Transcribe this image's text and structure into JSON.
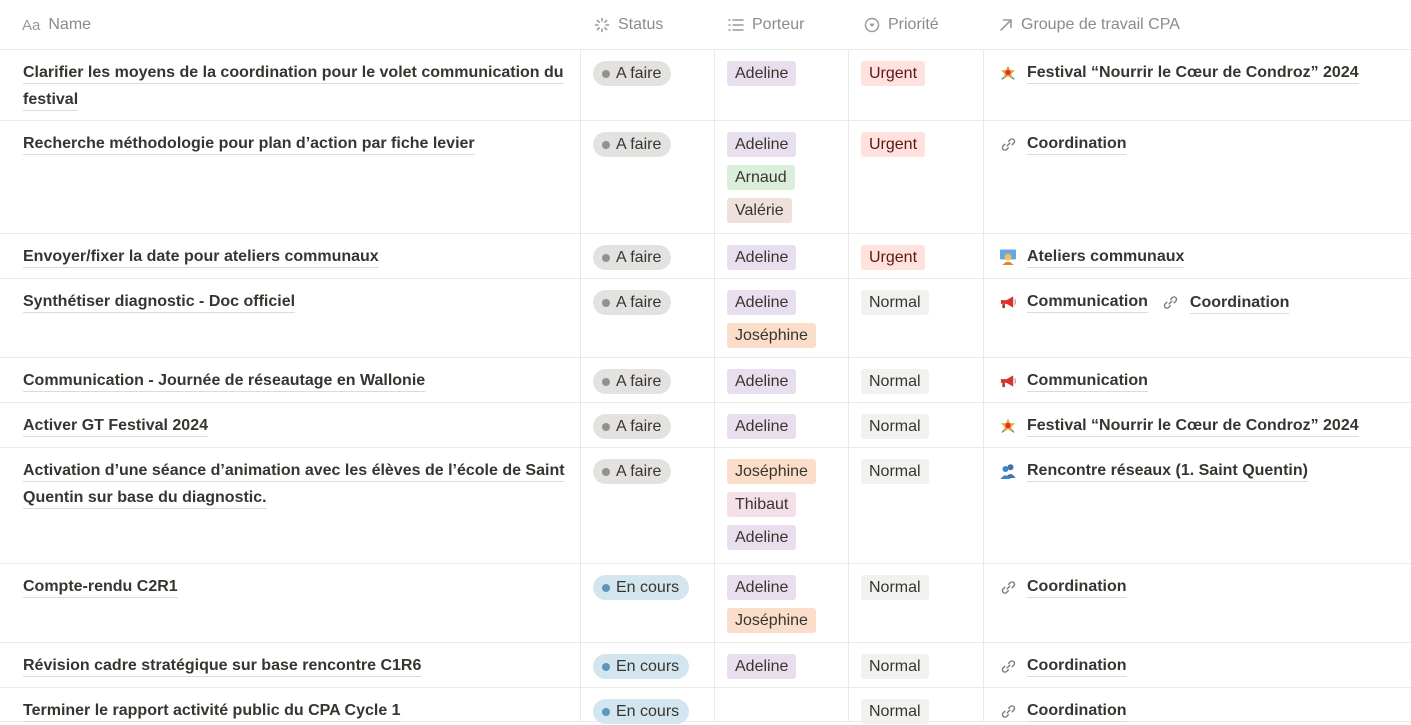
{
  "columns": {
    "name": "Name",
    "name_icon_text": "Aa",
    "status": "Status",
    "porteur": "Porteur",
    "priorite": "Priorité",
    "groupe": "Groupe de travail CPA"
  },
  "colors": {
    "status": {
      "A faire": {
        "bg": "#e3e2e0",
        "dot": "#91918e"
      },
      "En cours": {
        "bg": "#d3e5ef",
        "dot": "#5b97bd"
      }
    },
    "porteur": {
      "Adeline": "#e8deee",
      "Arnaud": "#dbeddb",
      "Valérie": "#eee0da",
      "Joséphine": "#fadec9",
      "Thibaut": "#f5e0e9"
    },
    "priorite": {
      "Urgent": "#ffe2dd",
      "Normal": "#f1f1ef"
    }
  },
  "rows": [
    {
      "name": "Clarifier les moyens de la coordination pour le volet communication du festival",
      "status": "A faire",
      "porteur": [
        "Adeline"
      ],
      "priorite": "Urgent",
      "groupe": [
        {
          "label": "Festival “Nourrir le Cœur de Condroz” 2024",
          "icon": "festival-icon"
        }
      ]
    },
    {
      "name": "Recherche méthodologie pour plan d’action par fiche levier",
      "status": "A faire",
      "porteur": [
        "Adeline",
        "Arnaud",
        "Valérie"
      ],
      "priorite": "Urgent",
      "groupe": [
        {
          "label": "Coordination",
          "icon": "link-icon"
        }
      ]
    },
    {
      "name": "Envoyer/fixer la date pour ateliers communaux",
      "status": "A faire",
      "porteur": [
        "Adeline"
      ],
      "priorite": "Urgent",
      "groupe": [
        {
          "label": "Ateliers communaux",
          "icon": "teacher-icon"
        }
      ]
    },
    {
      "name": "Synthétiser diagnostic - Doc officiel",
      "status": "A faire",
      "porteur": [
        "Adeline",
        "Joséphine"
      ],
      "priorite": "Normal",
      "groupe": [
        {
          "label": "Communication",
          "icon": "megaphone-icon"
        },
        {
          "label": "Coordination",
          "icon": "link-icon"
        }
      ]
    },
    {
      "name": "Communication - Journée de réseautage en Wallonie",
      "status": "A faire",
      "porteur": [
        "Adeline"
      ],
      "priorite": "Normal",
      "groupe": [
        {
          "label": "Communication",
          "icon": "megaphone-icon"
        }
      ]
    },
    {
      "name": "Activer GT Festival 2024",
      "status": "A faire",
      "porteur": [
        "Adeline"
      ],
      "priorite": "Normal",
      "groupe": [
        {
          "label": "Festival “Nourrir le Cœur de Condroz” 2024",
          "icon": "festival-icon"
        }
      ]
    },
    {
      "name": "Activation d’une séance d’animation avec les élèves de l’école de Saint Quentin sur base du diagnostic.",
      "status": "A faire",
      "porteur": [
        "Joséphine",
        "Thibaut",
        "Adeline"
      ],
      "priorite": "Normal",
      "groupe": [
        {
          "label": "Rencontre réseaux (1. Saint Quentin)",
          "icon": "people-icon"
        }
      ]
    },
    {
      "name": "Compte-rendu C2R1",
      "status": "En cours",
      "porteur": [
        "Adeline",
        "Joséphine"
      ],
      "priorite": "Normal",
      "groupe": [
        {
          "label": "Coordination",
          "icon": "link-icon"
        }
      ]
    },
    {
      "name": "Révision cadre stratégique sur base rencontre C1R6",
      "status": "En cours",
      "porteur": [
        "Adeline"
      ],
      "priorite": "Normal",
      "groupe": [
        {
          "label": "Coordination",
          "icon": "link-icon"
        }
      ]
    },
    {
      "name": "Terminer le rapport activité public du CPA Cycle 1",
      "status": "En cours",
      "porteur": [],
      "priorite": "Normal",
      "groupe": [
        {
          "label": "Coordination",
          "icon": "link-icon"
        }
      ]
    }
  ]
}
